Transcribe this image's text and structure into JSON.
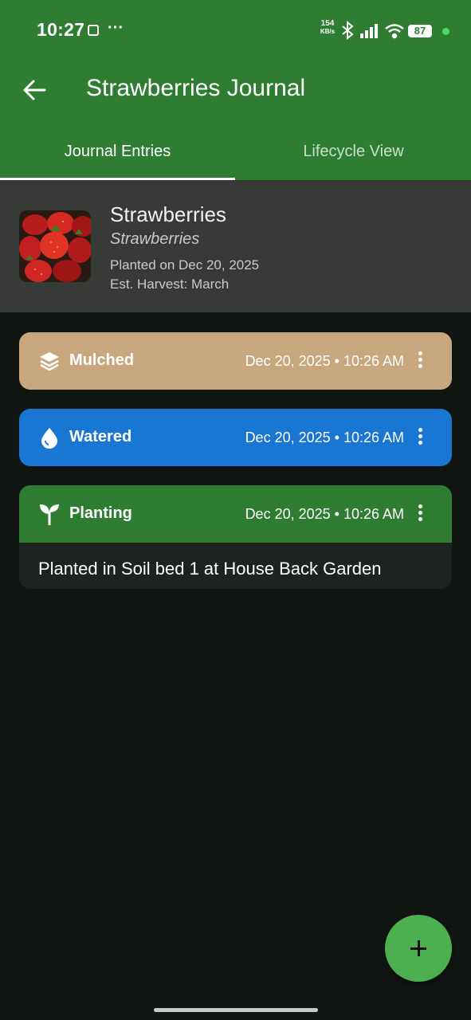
{
  "status_bar": {
    "time": "10:27",
    "speed_value": "154",
    "speed_unit": "KB/s",
    "battery": "87"
  },
  "app_bar": {
    "title": "Strawberries Journal",
    "back_icon": "arrow-left-icon"
  },
  "tabs": [
    {
      "label": "Journal Entries",
      "active": true
    },
    {
      "label": "Lifecycle View",
      "active": false
    }
  ],
  "plant": {
    "name": "Strawberries",
    "scientific_name": "Strawberries",
    "planted": "Planted on Dec 20, 2025",
    "harvest": "Est. Harvest: March"
  },
  "entries": [
    {
      "label": "Mulched",
      "icon": "layers-icon",
      "date": "Dec 20, 2025  •  10:26 AM",
      "color": "#c8a67e",
      "note": ""
    },
    {
      "label": "Watered",
      "icon": "water-drop-icon",
      "date": "Dec 20, 2025  •  10:26 AM",
      "color": "#1976d2",
      "note": ""
    },
    {
      "label": "Planting",
      "icon": "sprout-icon",
      "date": "Dec 20, 2025  •  10:26 AM",
      "color": "#2e7d32",
      "note": "Planted in Soil bed 1  at House Back Garden"
    }
  ],
  "fab": {
    "icon": "plus-icon"
  },
  "colors": {
    "primary": "#2e7d32",
    "background": "#111613",
    "fab": "#4caf50"
  }
}
